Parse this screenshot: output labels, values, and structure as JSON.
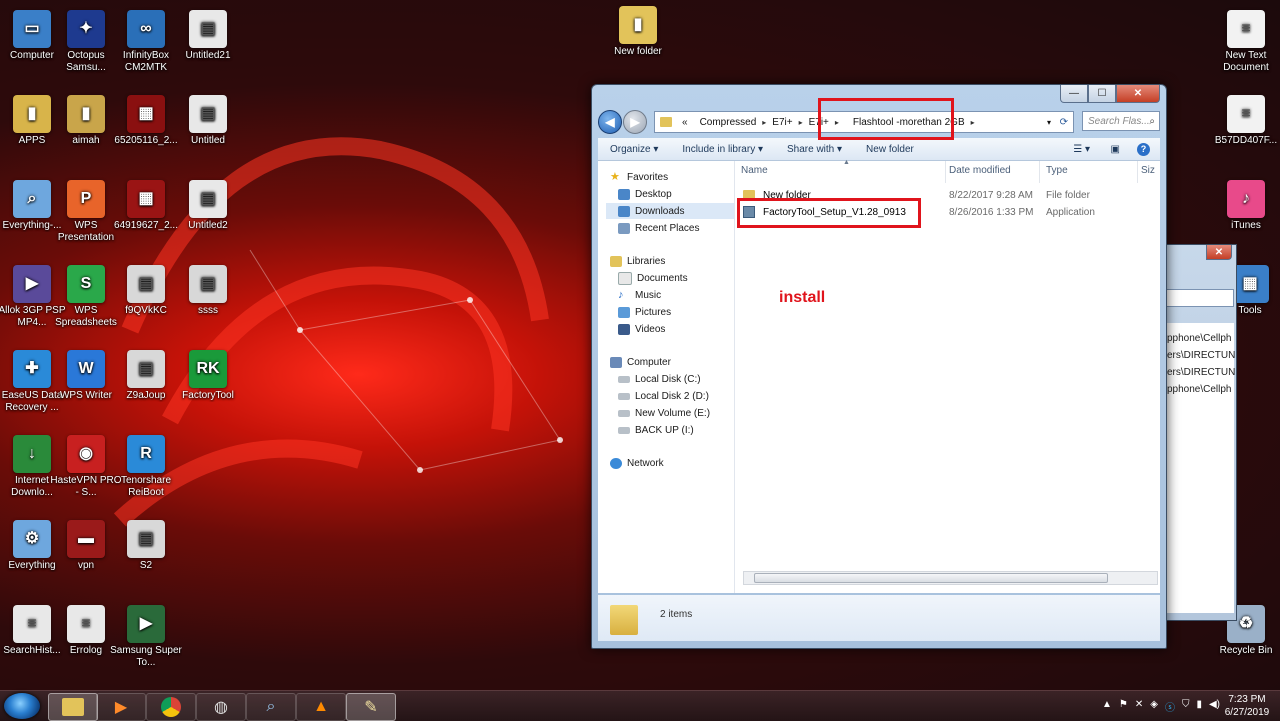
{
  "desktop_icons": [
    {
      "label": "Computer",
      "color": "#3a7fc8",
      "glyph": "▭"
    },
    {
      "label": "Octopus Samsu...",
      "color": "#1e3a8f",
      "glyph": "✦"
    },
    {
      "label": "InfinityBox CM2MTK",
      "color": "#2a6fb8",
      "glyph": "∞"
    },
    {
      "label": "Untitled21",
      "color": "#e8e8e8",
      "glyph": "▤"
    },
    {
      "label": "APPS",
      "color": "#d8b44a",
      "glyph": "▮"
    },
    {
      "label": "aimah",
      "color": "#c9a54a",
      "glyph": "▮"
    },
    {
      "label": "65205116_2...",
      "color": "#8a1010",
      "glyph": "▦"
    },
    {
      "label": "Untitled",
      "color": "#e8e8e8",
      "glyph": "▤"
    },
    {
      "label": "Everything-...",
      "color": "#6ea7de",
      "glyph": "⌕"
    },
    {
      "label": "WPS Presentation",
      "color": "#e8642a",
      "glyph": "P"
    },
    {
      "label": "64919627_2...",
      "color": "#9a1414",
      "glyph": "▦"
    },
    {
      "label": "Untitled2",
      "color": "#e8e8e8",
      "glyph": "▤"
    },
    {
      "label": "Allok 3GP PSP MP4...",
      "color": "#5a4a9a",
      "glyph": "▶"
    },
    {
      "label": "WPS Spreadsheets",
      "color": "#2aa84a",
      "glyph": "S"
    },
    {
      "label": "f9QVkKC",
      "color": "#d8d8d8",
      "glyph": "▤"
    },
    {
      "label": "ssss",
      "color": "#d8d8d8",
      "glyph": "▤"
    },
    {
      "label": "EaseUS Data Recovery ...",
      "color": "#2a8ad8",
      "glyph": "✚"
    },
    {
      "label": "WPS Writer",
      "color": "#2a78d8",
      "glyph": "W"
    },
    {
      "label": "Z9aJoup",
      "color": "#d8d8d8",
      "glyph": "▤"
    },
    {
      "label": "FactoryTool",
      "color": "#1a9a3a",
      "glyph": "RK"
    },
    {
      "label": "Internet Downlo...",
      "color": "#2a8a3a",
      "glyph": "↓"
    },
    {
      "label": "HasteVPN PRO - S...",
      "color": "#c82020",
      "glyph": "◉"
    },
    {
      "label": "Tenorshare ReiBoot",
      "color": "#2a8ad8",
      "glyph": "R"
    },
    {
      "label": "Everything",
      "color": "#6ea7de",
      "glyph": "⚙"
    },
    {
      "label": "vpn",
      "color": "#9a1a1a",
      "glyph": "▬"
    },
    {
      "label": "S2",
      "color": "#d8d8d8",
      "glyph": "▤"
    },
    {
      "label": "SearchHist...",
      "color": "#e8e8e8",
      "glyph": "≡"
    },
    {
      "label": "Errolog",
      "color": "#e8e8e8",
      "glyph": "≡"
    },
    {
      "label": "Samsung Super To...",
      "color": "#2a6a3a",
      "glyph": "▶"
    }
  ],
  "top_icons": [
    {
      "label": "New folder",
      "color": "#e2c35a",
      "glyph": "▮"
    },
    {
      "label": "New Text Document",
      "color": "#f2f2f2",
      "glyph": "≡"
    },
    {
      "label": "B57DD407F...",
      "color": "#f2f2f2",
      "glyph": "≡"
    },
    {
      "label": "iTunes",
      "color": "#e84a8a",
      "glyph": "♪"
    },
    {
      "label": "Tools",
      "color": "#3a7fc8",
      "glyph": "▦"
    },
    {
      "label": "Recycle Bin",
      "color": "#9ab0c8",
      "glyph": "♻"
    }
  ],
  "explorer": {
    "path": [
      "Compressed",
      "E7i+",
      "E7i+",
      "Flashtool -morethan 2GB"
    ],
    "path_prefix": "«",
    "search_placeholder": "Search Flas...",
    "toolbar": [
      "Organize ▾",
      "Include in library ▾",
      "Share with ▾",
      "New folder"
    ],
    "nav": {
      "favorites": "Favorites",
      "desktop": "Desktop",
      "downloads": "Downloads",
      "recent": "Recent Places",
      "libraries": "Libraries",
      "documents": "Documents",
      "music": "Music",
      "pictures": "Pictures",
      "videos": "Videos",
      "computer": "Computer",
      "disk_c": "Local Disk (C:)",
      "disk_d": "Local Disk 2 (D:)",
      "disk_e": "New Volume (E:)",
      "disk_i": "BACK UP  (I:)",
      "network": "Network"
    },
    "columns": {
      "name": "Name",
      "date": "Date modified",
      "type": "Type",
      "size": "Siz"
    },
    "files": [
      {
        "name": "New folder",
        "date": "8/22/2017 9:28 AM",
        "type": "File folder"
      },
      {
        "name": "FactoryTool_Setup_V1.28_0913",
        "date": "8/26/2016 1:33 PM",
        "type": "Application"
      }
    ],
    "status": "2 items"
  },
  "annotation": "install",
  "bg_window_lines": [
    "pphone\\Cellph",
    "ers\\DIRECTUN",
    "ers\\DIRECTUN",
    "pphone\\Cellph"
  ],
  "clock": {
    "time": "7:23 PM",
    "date": "6/27/2019"
  }
}
